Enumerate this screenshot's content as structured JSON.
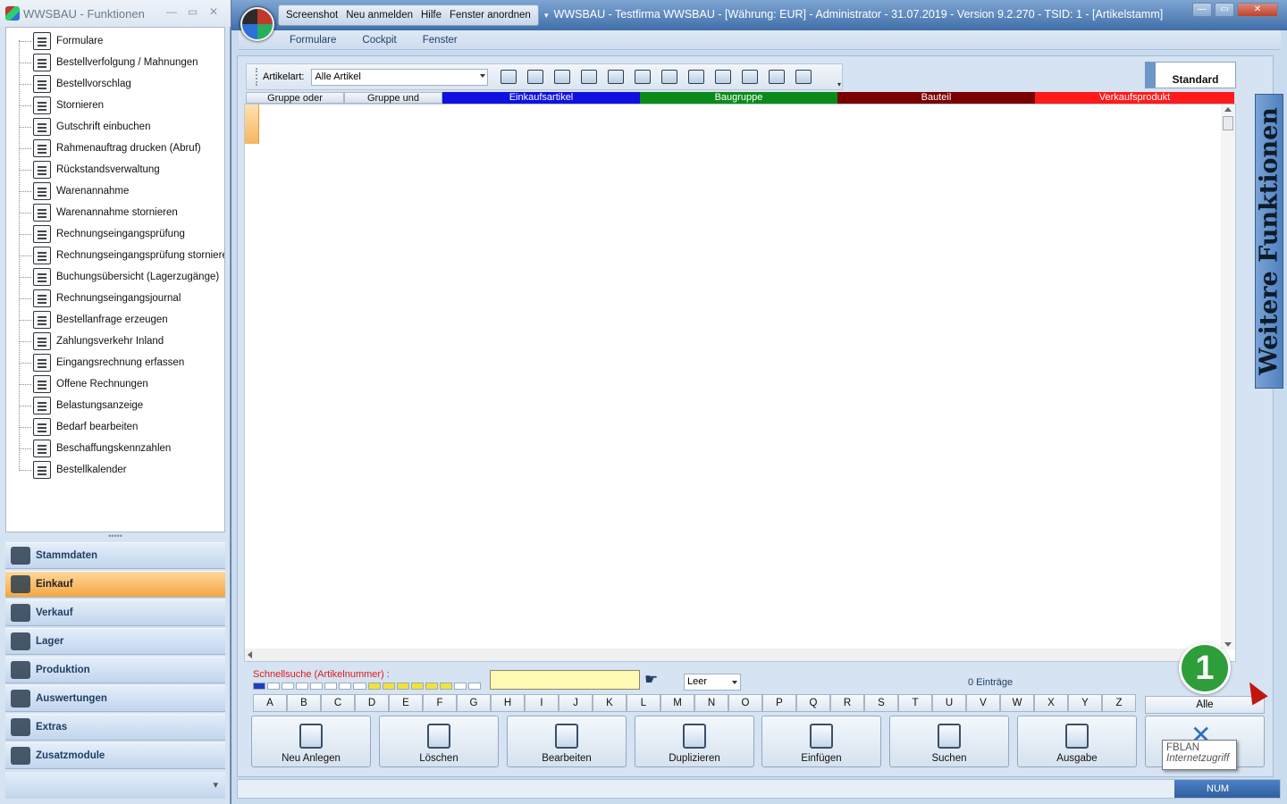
{
  "left_window": {
    "title": "WWSBAU - Funktionen",
    "tree_items": [
      "Formulare",
      "Bestellverfolgung / Mahnungen",
      "Bestellvorschlag",
      "Stornieren",
      "Gutschrift einbuchen",
      "Rahmenauftrag drucken (Abruf)",
      "Rückstandsverwaltung",
      "Warenannahme",
      "Warenannahme stornieren",
      "Rechnungseingangsprüfung",
      "Rechnungseingangsprüfung stornieren",
      "Buchungsübersicht (Lagerzugänge)",
      "Rechnungseingangsjournal",
      "Bestellanfrage erzeugen",
      "Zahlungsverkehr Inland",
      "Eingangsrechnung erfassen",
      "Offene Rechnungen",
      "Belastungsanzeige",
      "Bedarf bearbeiten",
      "Beschaffungskennzahlen",
      "Bestellkalender"
    ],
    "nav_items": [
      "Stammdaten",
      "Einkauf",
      "Verkauf",
      "Lager",
      "Produktion",
      "Auswertungen",
      "Extras",
      "Zusatzmodule"
    ],
    "active_nav": "Einkauf"
  },
  "main_window": {
    "quick_menu": [
      "Screenshot",
      "Neu anmelden",
      "Hilfe",
      "Fenster anordnen"
    ],
    "title": "WWSBAU - Testfirma WWSBAU - [Währung: EUR] - Administrator - 31.07.2019 - Version 9.2.270 - TSID: 1  - [Artikelstamm]",
    "menu": [
      "Formulare",
      "Cockpit",
      "Fenster"
    ]
  },
  "toolbar": {
    "label": "Artikelart:",
    "artikelart_value": "Alle Artikel",
    "standard_label": "Standard"
  },
  "column_headers": [
    {
      "label": "Gruppe oder",
      "color": "#d6e0eb"
    },
    {
      "label": "Gruppe und",
      "color": "#d6e0eb"
    },
    {
      "label": "Einkaufsartikel",
      "color": "#1010e0"
    },
    {
      "label": "Baugruppe",
      "color": "#0b8a1a"
    },
    {
      "label": "Bauteil",
      "color": "#7a0000"
    },
    {
      "label": "Verkaufsprodukt",
      "color": "#ff1a1a"
    }
  ],
  "side_tab": "Weitere Funktionen",
  "quicksearch": {
    "label": "Schnellsuche (Artikelnummer) :",
    "value": "",
    "mode": "Leer",
    "entries": "0 Einträge"
  },
  "alphabet": [
    "A",
    "B",
    "C",
    "D",
    "E",
    "F",
    "G",
    "H",
    "I",
    "J",
    "K",
    "L",
    "M",
    "N",
    "O",
    "P",
    "Q",
    "R",
    "S",
    "T",
    "U",
    "V",
    "W",
    "X",
    "Y",
    "Z"
  ],
  "alle_label": "Alle",
  "actions": [
    "Neu Anlegen",
    "Löschen",
    "Bearbeiten",
    "Duplizieren",
    "Einfügen",
    "Suchen",
    "Ausgabe"
  ],
  "tooltip": {
    "line1": "FBLAN",
    "line2": "Internetzugriff"
  },
  "badge": "1",
  "status": {
    "num": "NUM"
  }
}
